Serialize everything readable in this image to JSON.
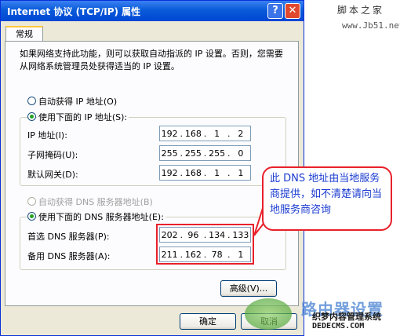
{
  "window": {
    "title": "Internet 协议 (TCP/IP) 属性",
    "help_label": "?",
    "close_label": "✕"
  },
  "tabs": [
    {
      "label": "常规"
    }
  ],
  "description": "如果网络支持此功能，则可以获取自动指派的 IP 设置。否则，您需要从网络系统管理员处获得适当的 IP 设置。",
  "ip_section": {
    "auto_label": "自动获得 IP 地址(O)",
    "manual_label": "使用下面的 IP 地址(S):",
    "selected": "manual",
    "fields": [
      {
        "label": "IP 地址(I):",
        "octets": [
          "192",
          "168",
          "1",
          "2"
        ]
      },
      {
        "label": "子网掩码(U):",
        "octets": [
          "255",
          "255",
          "255",
          "0"
        ]
      },
      {
        "label": "默认网关(D):",
        "octets": [
          "192",
          "168",
          "1",
          "1"
        ]
      }
    ]
  },
  "dns_section": {
    "auto_label": "自动获得 DNS 服务器地址(B)",
    "manual_label": "使用下面的 DNS 服务器地址(E):",
    "selected": "manual",
    "fields": [
      {
        "label": "首选 DNS 服务器(P):",
        "octets": [
          "202",
          "96",
          "134",
          "133"
        ]
      },
      {
        "label": "备用 DNS 服务器(A):",
        "octets": [
          "211",
          "162",
          "78",
          "1"
        ]
      }
    ]
  },
  "buttons": {
    "advanced": "高级(V)...",
    "ok": "确定",
    "cancel": "取消"
  },
  "callout": "此 DNS 地址由当地服务商提供，如不清楚请向当地服务商咨询",
  "watermarks": {
    "site_name": "脚本之家",
    "site_url": "www.Jb51.net",
    "router_text": "路由器设置",
    "cms_text": "织梦内容管理系统",
    "cms_url": "DEDECMS.COM"
  },
  "colors": {
    "accent_red": "#e8202a",
    "titlebar_blue": "#0a5bd8"
  }
}
